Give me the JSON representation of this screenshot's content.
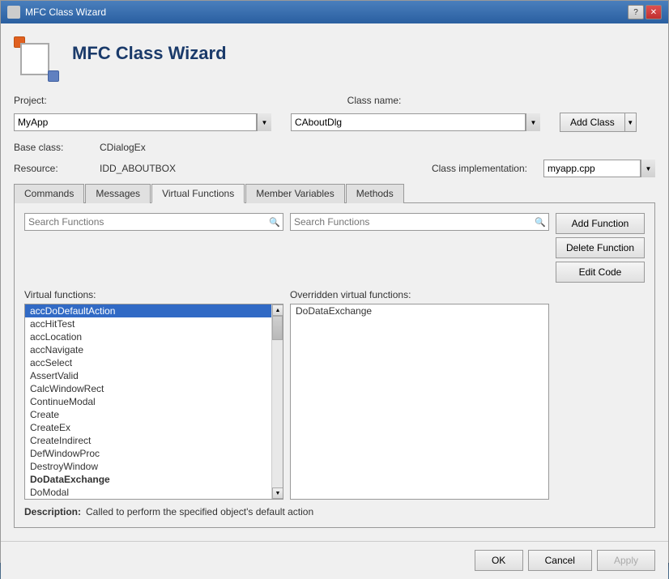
{
  "window": {
    "title": "MFC Class Wizard"
  },
  "header": {
    "title": "MFC Class Wizard"
  },
  "form": {
    "project_label": "Project:",
    "project_value": "MyApp",
    "classname_label": "Class name:",
    "classname_value": "CAboutDlg",
    "baseclass_label": "Base class:",
    "baseclass_value": "CDialogEx",
    "resource_label": "Resource:",
    "resource_value": "IDD_ABOUTBOX",
    "classimpl_label": "Class implementation:",
    "classimpl_value": "myapp.cpp",
    "add_class_label": "Add Class"
  },
  "tabs": [
    {
      "label": "Commands",
      "active": false
    },
    {
      "label": "Messages",
      "active": false
    },
    {
      "label": "Virtual Functions",
      "active": true
    },
    {
      "label": "Member Variables",
      "active": false
    },
    {
      "label": "Methods",
      "active": false
    }
  ],
  "virtual_functions": {
    "search_left_placeholder": "Search Functions",
    "search_right_placeholder": "Search Functions",
    "virtual_label": "Virtual functions:",
    "overridden_label": "Overridden virtual functions:",
    "add_btn": "Add Function",
    "delete_btn": "Delete Function",
    "edit_btn": "Edit Code",
    "functions": [
      {
        "name": "accDoDefaultAction",
        "bold": false,
        "selected": true
      },
      {
        "name": "accHitTest",
        "bold": false
      },
      {
        "name": "accLocation",
        "bold": false
      },
      {
        "name": "accNavigate",
        "bold": false
      },
      {
        "name": "accSelect",
        "bold": false
      },
      {
        "name": "AssertValid",
        "bold": false
      },
      {
        "name": "CalcWindowRect",
        "bold": false
      },
      {
        "name": "ContinueModal",
        "bold": false
      },
      {
        "name": "Create",
        "bold": false
      },
      {
        "name": "CreateEx",
        "bold": false
      },
      {
        "name": "CreateIndirect",
        "bold": false
      },
      {
        "name": "DefWindowProc",
        "bold": false
      },
      {
        "name": "DestroyWindow",
        "bold": false
      },
      {
        "name": "DoDataExchange",
        "bold": true
      },
      {
        "name": "DoModal",
        "bold": false
      }
    ],
    "overridden": [
      {
        "name": "DoDataExchange",
        "bold": false
      }
    ],
    "description_label": "Description:",
    "description_text": "Called to perform the specified object's default action"
  },
  "footer": {
    "ok_label": "OK",
    "cancel_label": "Cancel",
    "apply_label": "Apply"
  }
}
